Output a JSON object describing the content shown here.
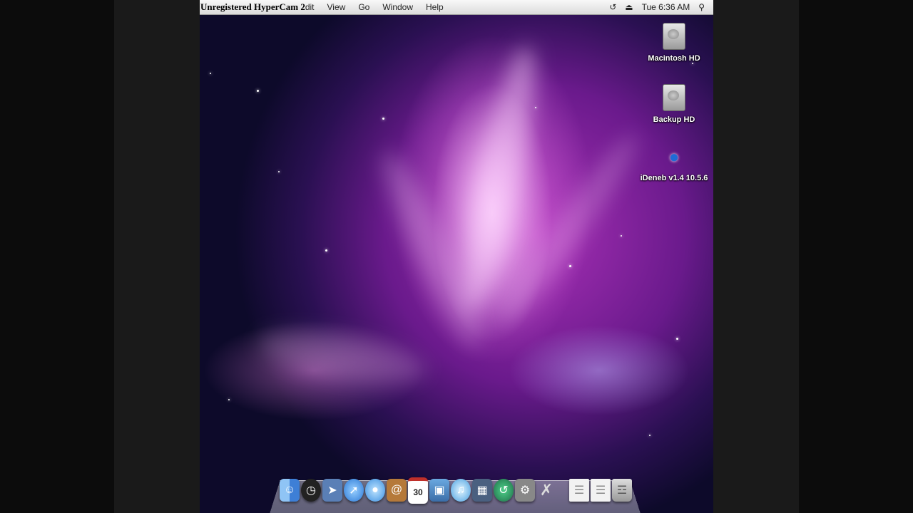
{
  "watermark": "Unregistered HyperCam 2",
  "menubar": {
    "items": [
      "dit",
      "View",
      "Go",
      "Window",
      "Help"
    ],
    "clock": "Tue 6:36 AM"
  },
  "desktop_icons": [
    {
      "label": "Macintosh HD",
      "icon": "hard-drive-icon"
    },
    {
      "label": "Backup HD",
      "icon": "hard-drive-icon"
    },
    {
      "label": "iDeneb v1.4 10.5.6",
      "icon": "apple-disk-icon"
    }
  ],
  "dock": {
    "icons": [
      "finder-icon",
      "dashboard-icon",
      "mail-icon",
      "safari-icon",
      "ichat-icon",
      "address-book-icon",
      "ical-icon",
      "iphoto-icon",
      "itunes-icon",
      "spaces-icon",
      "time-machine-icon",
      "system-preferences-icon",
      "utilities-icon",
      "document-icon",
      "document-icon",
      "trash-icon"
    ],
    "ical_date": "30"
  },
  "colors": {
    "menubar": "#e8e8e8",
    "wallpaper_primary": "#a730b5",
    "wallpaper_dark": "#0d0a2a"
  }
}
